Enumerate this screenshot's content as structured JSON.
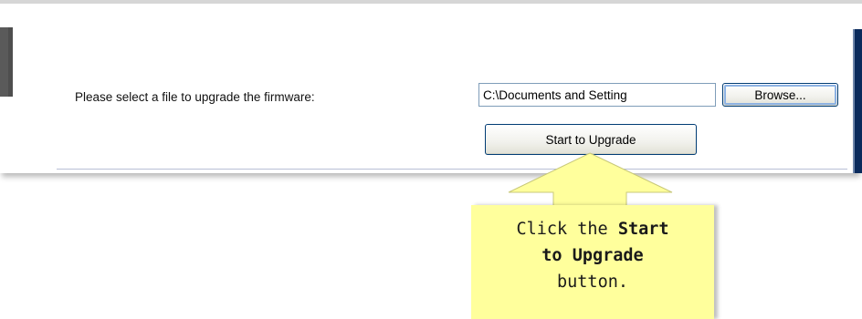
{
  "form": {
    "prompt_label": "Please select a file to upgrade the firmware:",
    "file_value": "C:\\Documents and Setting",
    "browse_label": "Browse...",
    "upgrade_label": "Start to Upgrade"
  },
  "callout": {
    "line1_prefix": "Click the",
    "line1_bold": "Start",
    "line2_bold": "to Upgrade",
    "line3": "button."
  },
  "colors": {
    "callout_fill": "#ffff9c",
    "button_border": "#003c74",
    "focus_ring": "#8db2e3",
    "input_border": "#7f9db9",
    "right_border": "#0a2a5c"
  }
}
